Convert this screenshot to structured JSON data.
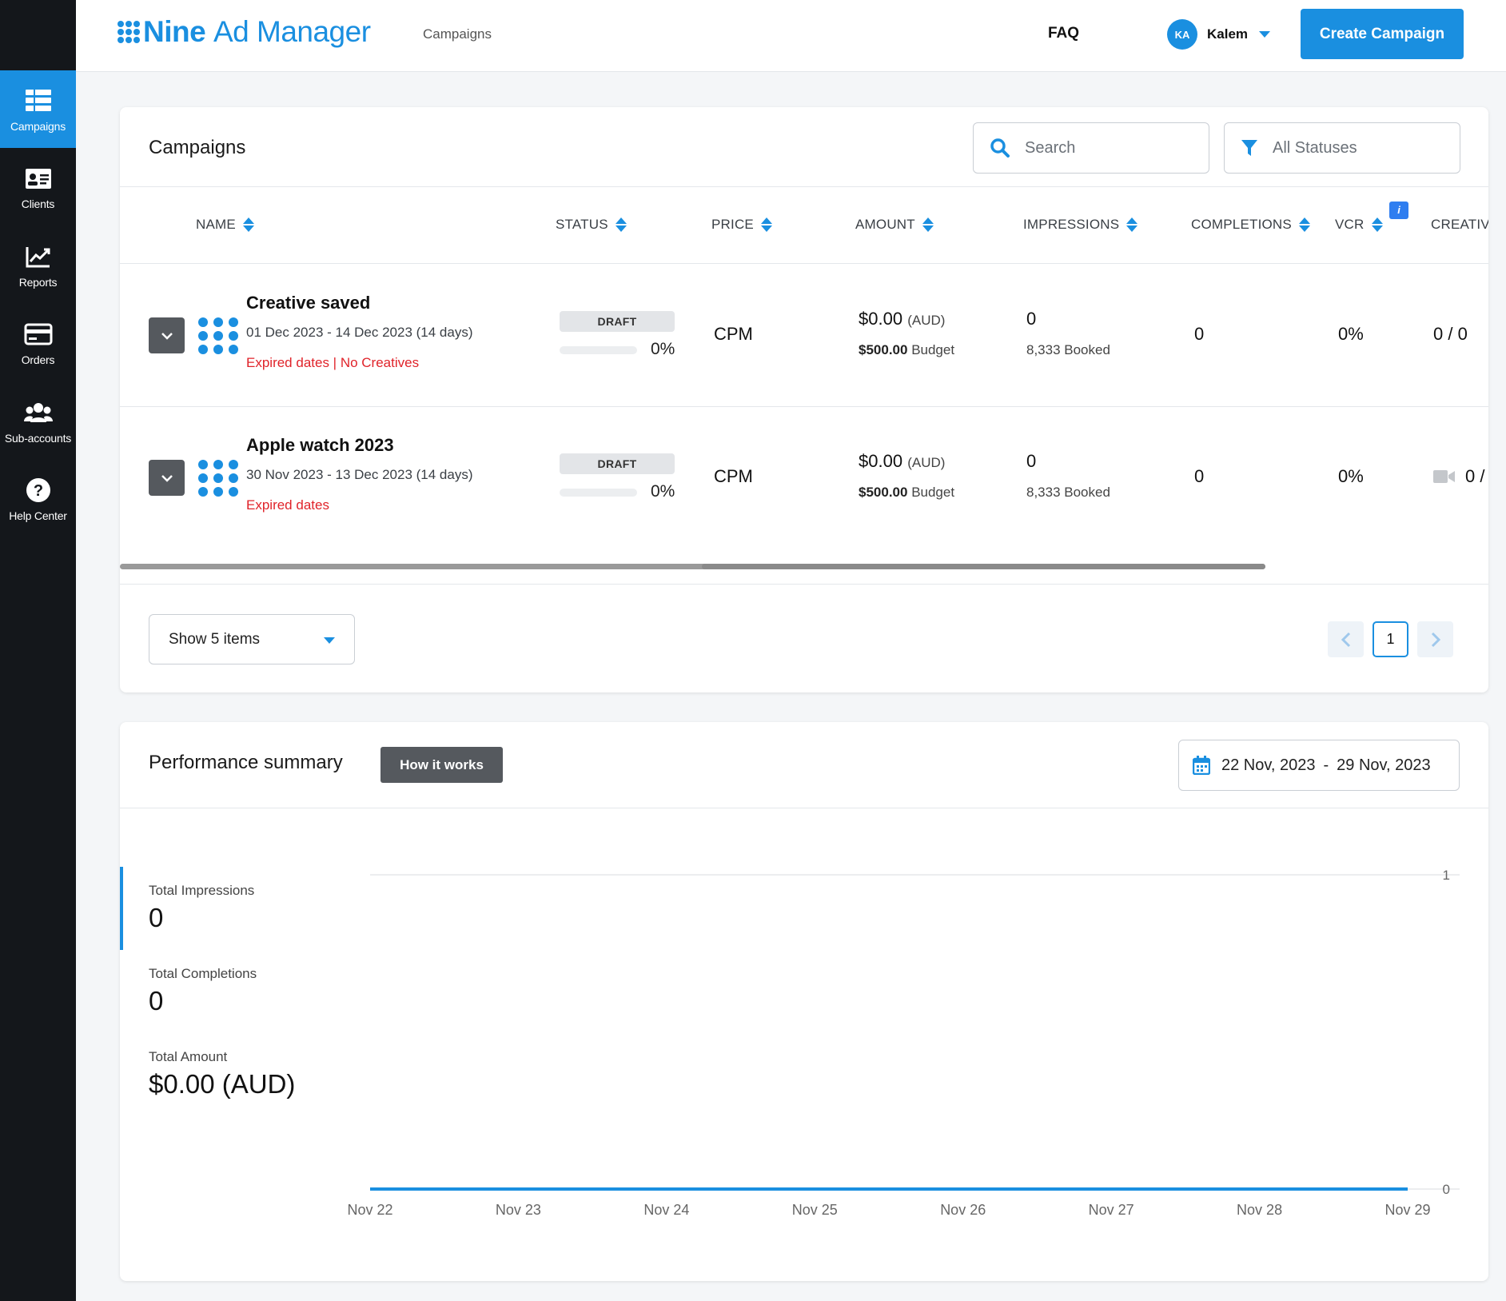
{
  "app": {
    "logo_brand": "Nine",
    "logo_product": "Ad Manager",
    "breadcrumb": "Campaigns",
    "faq": "FAQ",
    "user": {
      "initials": "KA",
      "name": "Kalem"
    },
    "create_button": "Create Campaign",
    "accent_color": "#1a8fe0"
  },
  "sidebar": {
    "items": [
      {
        "label": "Campaigns",
        "icon": "table-icon",
        "active": true
      },
      {
        "label": "Clients",
        "icon": "id-card-icon",
        "active": false
      },
      {
        "label": "Reports",
        "icon": "chart-line-icon",
        "active": false
      },
      {
        "label": "Orders",
        "icon": "credit-card-icon",
        "active": false
      },
      {
        "label": "Sub-accounts",
        "icon": "users-icon",
        "active": false
      },
      {
        "label": "Help Center",
        "icon": "question-circle-icon",
        "active": false
      }
    ]
  },
  "campaigns": {
    "title": "Campaigns",
    "search_placeholder": "Search",
    "status_filter": "All Statuses",
    "columns": [
      "NAME",
      "STATUS",
      "PRICE",
      "AMOUNT",
      "IMPRESSIONS",
      "COMPLETIONS",
      "VCR",
      "CREATIV"
    ],
    "info_badge": "i",
    "rows": [
      {
        "name": "Creative saved",
        "dates": "01 Dec 2023 - 14 Dec 2023 (14 days)",
        "warning": "Expired dates | No Creatives",
        "status": "DRAFT",
        "progress": 0,
        "progress_label": "0%",
        "price": "CPM",
        "amount": "$0.00",
        "currency": "(AUD)",
        "budget_value": "$500.00",
        "budget_label": "Budget",
        "impressions": "0",
        "booked": "8,333 Booked",
        "completions": "0",
        "vcr": "0%",
        "creatives": "0 / 0"
      },
      {
        "name": "Apple watch 2023",
        "dates": "30 Nov 2023 - 13 Dec 2023 (14 days)",
        "warning": "Expired dates",
        "status": "DRAFT",
        "progress": 0,
        "progress_label": "0%",
        "price": "CPM",
        "amount": "$0.00",
        "currency": "(AUD)",
        "budget_value": "$500.00",
        "budget_label": "Budget",
        "impressions": "0",
        "booked": "8,333 Booked",
        "completions": "0",
        "vcr": "0%",
        "creatives": "0 /"
      }
    ],
    "page_size": "Show 5 items",
    "current_page": "1"
  },
  "performance": {
    "title": "Performance summary",
    "how_button": "How it works",
    "date_from": "22 Nov, 2023",
    "date_sep": "-",
    "date_to": "29 Nov, 2023",
    "metrics": [
      {
        "label": "Total Impressions",
        "value": "0",
        "selected": true
      },
      {
        "label": "Total Completions",
        "value": "0",
        "selected": false
      },
      {
        "label": "Total Amount",
        "value": "$0.00 (AUD)",
        "selected": false
      }
    ]
  },
  "chart_data": {
    "type": "line",
    "title": "",
    "xlabel": "",
    "ylabel": "",
    "categories": [
      "Nov 22",
      "Nov 23",
      "Nov 24",
      "Nov 25",
      "Nov 26",
      "Nov 27",
      "Nov 28",
      "Nov 29"
    ],
    "series": [
      {
        "values": [
          0,
          0,
          0,
          0,
          0,
          0,
          0,
          0
        ],
        "color": "#1a8fe0"
      }
    ],
    "ylim": [
      0,
      1
    ],
    "y_ticks": [
      "1",
      "0"
    ],
    "grid": true,
    "legend": "none"
  }
}
